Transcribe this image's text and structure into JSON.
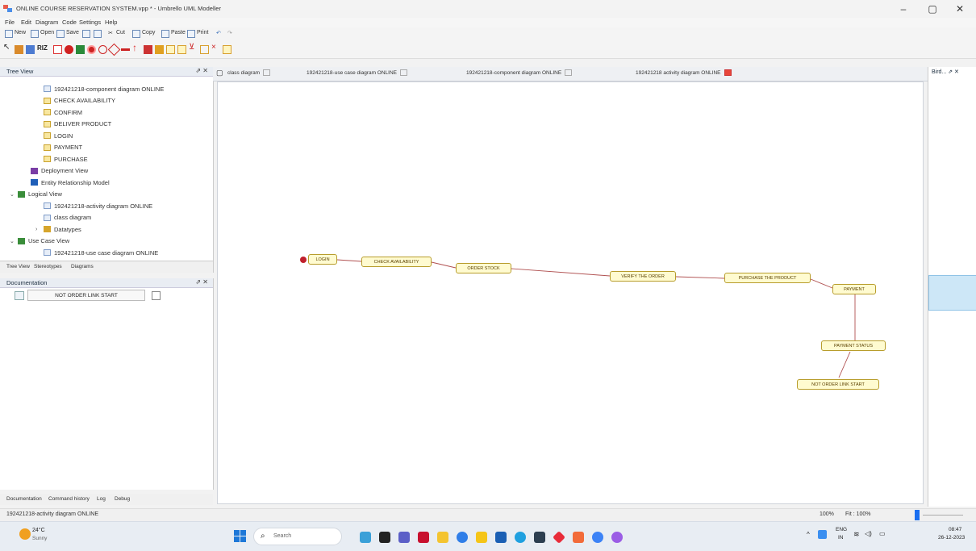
{
  "window": {
    "title": "ONLINE COURSE RESERVATION SYSTEM.vpp * - Umbrello UML Modeller",
    "buttons": {
      "minimize": "–",
      "maximize": "▢",
      "close": "✕"
    }
  },
  "menu": [
    "File",
    "Edit",
    "Diagram",
    "Code",
    "Settings",
    "Help"
  ],
  "toolbar": {
    "labels": [
      "New",
      "Open",
      "Save",
      "Cut",
      "Copy",
      "Paste",
      "Print"
    ]
  },
  "tree_view": {
    "title": "Tree View",
    "items": [
      {
        "label": "192421218-component diagram ONLINE",
        "icon": "diagram-icon",
        "indent": 3
      },
      {
        "label": "CHECK AVAILABILITY",
        "icon": "state-icon",
        "indent": 3
      },
      {
        "label": "CONFIRM",
        "icon": "state-icon",
        "indent": 3
      },
      {
        "label": "DELIVER PRODUCT",
        "icon": "state-icon",
        "indent": 3
      },
      {
        "label": "LOGIN",
        "icon": "state-icon",
        "indent": 3
      },
      {
        "label": "PAYMENT",
        "icon": "state-icon",
        "indent": 3
      },
      {
        "label": "PURCHASE",
        "icon": "state-icon",
        "indent": 3
      },
      {
        "label": "Deployment View",
        "icon": "purple-folder-icon",
        "indent": 2
      },
      {
        "label": "Entity Relationship Model",
        "icon": "blue-folder-icon",
        "indent": 2
      },
      {
        "label": "Logical View",
        "icon": "green-folder-icon",
        "indent": 1,
        "expander": "⌄"
      },
      {
        "label": "192421218-activity diagram ONLINE",
        "icon": "diagram-icon",
        "indent": 3
      },
      {
        "label": "class diagram",
        "icon": "diagram-icon",
        "indent": 3
      },
      {
        "label": "Datatypes",
        "icon": "folder-icon",
        "indent": 3,
        "expander": "›"
      },
      {
        "label": "Use Case View",
        "icon": "green-folder-icon",
        "indent": 1,
        "expander": "⌄"
      },
      {
        "label": "192421218-use case diagram ONLINE",
        "icon": "diagram-icon",
        "indent": 3
      }
    ],
    "tabs": [
      "Tree View",
      "Stereotypes",
      "Diagrams"
    ],
    "controls": "⇗ ✕"
  },
  "documentation": {
    "title": "Documentation",
    "field_value": "NOT ORDER LINK START",
    "controls": "⇗ ✕"
  },
  "bottom_tabs": [
    "Documentation",
    "Command history",
    "Log",
    "Debug"
  ],
  "diagram_tabs": [
    {
      "label": "class diagram",
      "active": false
    },
    {
      "label": "192421218-use case diagram ONLINE",
      "active": false
    },
    {
      "label": "192421218-component diagram ONLINE",
      "active": false
    },
    {
      "label": "192421218 activity diagram ONLINE",
      "active": true
    }
  ],
  "right_panel": {
    "title": "Bird... ⇗ ✕"
  },
  "diagram": {
    "nodes": [
      {
        "id": "n1",
        "label": "LOGIN"
      },
      {
        "id": "n2",
        "label": "CHECK AVAILABILITY"
      },
      {
        "id": "n3",
        "label": "ORDER STOCK"
      },
      {
        "id": "n4",
        "label": "VERIFY THE ORDER"
      },
      {
        "id": "n5",
        "label": "PURCHASE THE PRODUCT"
      },
      {
        "id": "n6",
        "label": "PAYMENT"
      },
      {
        "id": "n7",
        "label": "PAYMENT STATUS"
      },
      {
        "id": "n8",
        "label": "NOT ORDER LINK START"
      }
    ]
  },
  "status": {
    "left": "192421218-activity diagram ONLINE",
    "zoom": "100%",
    "fit": "Fit : 100%"
  },
  "taskbar": {
    "weather_temp": "24°C",
    "weather_desc": "Sunny",
    "search_placeholder": "Search",
    "language": "ENG",
    "region": "IN",
    "time": "08:47",
    "date": "26-12-2023"
  },
  "colors": {
    "node_fill": "#fffbd0",
    "node_border": "#b89d2c",
    "edge": "#b05050",
    "initial_node": "#c0202c"
  }
}
